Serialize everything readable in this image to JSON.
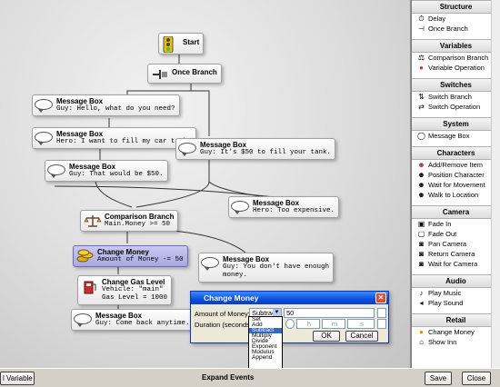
{
  "nodes": {
    "start": "Start",
    "once_branch": "Once Branch",
    "msg1": {
      "title": "Message Box",
      "text": "Guy: Hello, what do you need?"
    },
    "msg2": {
      "title": "Message Box",
      "text": "Hero: I want to fill my car tank."
    },
    "msg3": {
      "title": "Message Box",
      "text": "Guy: It's $50 to fill your tank."
    },
    "msg4": {
      "title": "Message Box",
      "text": "Guy: That would be $50."
    },
    "msg5": {
      "title": "Message Box",
      "text": "Hero: Too expensive."
    },
    "comparison": {
      "title": "Comparison Branch",
      "text": "Main.Money >= 50"
    },
    "change_money": {
      "title": "Change Money",
      "text": "Amount of Money -= 50"
    },
    "msg6": {
      "title": "Message Box",
      "text1": "Guy: You don't have enough",
      "text2": "money."
    },
    "gas": {
      "title": "Change Gas Level",
      "text1": "Vehicle: \"main\"",
      "text2": "Gas Level = 1000"
    },
    "msg7": {
      "title": "Message Box",
      "text": "Guy: Come back anytime."
    }
  },
  "panel": {
    "structure": {
      "header": "Structure",
      "items": [
        "Delay",
        "Once Branch"
      ]
    },
    "variables": {
      "header": "Variables",
      "items": [
        "Comparison Branch",
        "Variable Operation"
      ]
    },
    "switches": {
      "header": "Switches",
      "items": [
        "Switch Branch",
        "Switch Operation"
      ]
    },
    "system": {
      "header": "System",
      "items": [
        "Message Box"
      ]
    },
    "characters": {
      "header": "Characters",
      "items": [
        "Add/Remove Item",
        "Position Character",
        "Wait for Movement",
        "Walk to Location"
      ]
    },
    "camera": {
      "header": "Camera",
      "items": [
        "Fade In",
        "Fade Out",
        "Pan Camera",
        "Return Camera",
        "Wait for Camera"
      ]
    },
    "audio": {
      "header": "Audio",
      "items": [
        "Play Music",
        "Play Sound"
      ]
    },
    "retail": {
      "header": "Retail",
      "items": [
        "Change Money",
        "Show Inn"
      ]
    }
  },
  "dialog": {
    "title": "Change Money",
    "amount_label": "Amount of Money:",
    "operation": "Subtract",
    "value": "50",
    "duration_label": "Duration (seconds):",
    "h": "h",
    "m": "m",
    "s": "s",
    "ok": "OK",
    "cancel": "Cancel",
    "options": [
      "Set",
      "Add",
      "Subtract",
      "Multiply",
      "Divide",
      "Exponent",
      "Modulus",
      "Append"
    ]
  },
  "bottom": {
    "variable": "l Variable",
    "expand": "Expand Events",
    "save": "Save",
    "close": "Close"
  }
}
